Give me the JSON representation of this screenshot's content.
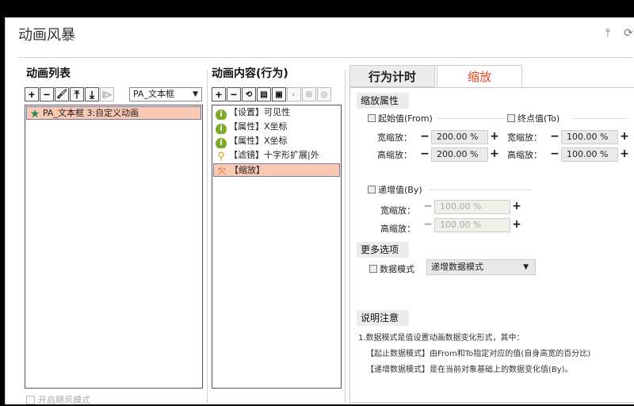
{
  "window": {
    "title": "动画风暴"
  },
  "left_panel": {
    "label": "动画列表",
    "toolbar": {
      "add": "+",
      "remove": "−",
      "brush": "🖌",
      "move_top": "⤒",
      "move_bottom": "⤓",
      "step": "⧐"
    },
    "target_select": "PA_文本框",
    "items": [
      "PA_文本框 3:自定义动画"
    ],
    "wind_mode_label": "开启飓风模式"
  },
  "middle_panel": {
    "label": "动画内容(行为)",
    "items": [
      {
        "icon": "info-icon",
        "text": "【设置】可见性"
      },
      {
        "icon": "info-icon",
        "text": "【属性】X坐标"
      },
      {
        "icon": "info-icon",
        "text": "【属性】X坐标"
      },
      {
        "icon": "search-icon",
        "text": "【滤镜】十字形扩展|外"
      },
      {
        "icon": "scale-icon",
        "text": "【缩放】"
      }
    ]
  },
  "tabs": {
    "timing": "行为计时",
    "scale": "缩放"
  },
  "scale_props": {
    "header": "缩放属性",
    "from": {
      "label": "起始值(From)",
      "width_label": "宽缩放：",
      "width_value": "200.00 %",
      "height_label": "高缩放：",
      "height_value": "200.00 %"
    },
    "to": {
      "label": "终点值(To)",
      "width_label": "宽缩放：",
      "width_value": "100.00 %",
      "height_label": "高缩放：",
      "height_value": "100.00 %"
    },
    "by": {
      "label": "递增值(By)",
      "width_label": "宽缩放：",
      "width_value": "100.00 %",
      "height_label": "高缩放：",
      "height_value": "100.00 %"
    }
  },
  "more_options": {
    "header": "更多选项",
    "data_mode_label": "数据模式",
    "data_mode_value": "递增数据模式"
  },
  "notes": {
    "header": "说明注意",
    "lines": [
      "1.数据模式是值设置动画数据变化形式，其中：",
      "【起止数据模式】由From和To指定对应的值(自身高宽的百分比)",
      "【递增数据模式】是在当前对象基础上的数据变化值(By)。"
    ]
  },
  "stepper": {
    "minus": "−",
    "plus": "+"
  }
}
